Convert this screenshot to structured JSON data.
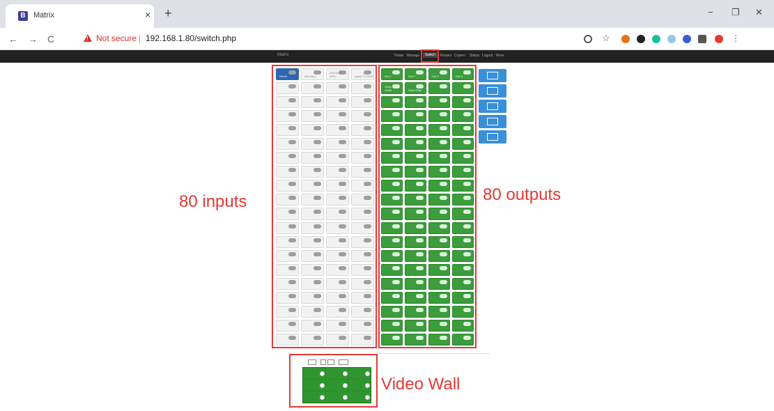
{
  "browser": {
    "tab_title": "Matrix",
    "tab_favicon": "B",
    "tab_close": "×",
    "new_tab": "+",
    "security_text": "Not secure",
    "separator": "|",
    "url": "192.168.1.80/switch.php",
    "window_controls": [
      "−",
      "❐",
      "✕"
    ],
    "nav": {
      "back": "←",
      "forward": "→",
      "reload": "C"
    }
  },
  "site": {
    "brand": "Matrix",
    "nav_items": [
      "Home",
      "Manage",
      "Switch",
      "Routes",
      "Copies",
      "Status",
      "Logout",
      "More"
    ],
    "active_nav_index": 2
  },
  "inputs": {
    "count": 80,
    "selected_index": 0,
    "labels": [
      "Win10",
      "Win10ips",
      "Self Video 4IPS",
      "Apple TV 4GIS"
    ]
  },
  "outputs": {
    "count": 80,
    "labels": [
      "Out 1",
      "Out 2",
      "Out 3",
      "Out 4",
      "Video Wall HDMI",
      "Video Wall"
    ]
  },
  "annotations": {
    "inputs_label": "80 inputs",
    "outputs_label": "80 outputs",
    "videowall_label": "Video Wall"
  },
  "video_wall": {
    "rows": 3,
    "cols": 3
  },
  "colors": {
    "output_green": "#3b9d3b",
    "input_gray": "#f2f2f2",
    "selected_blue": "#2c67b3",
    "annotation_red": "#e53935",
    "side_button_blue": "#3a8fd9"
  },
  "icons": [
    "search-icon",
    "star-icon",
    "extension-icon",
    "save-icon",
    "layout-icon"
  ]
}
